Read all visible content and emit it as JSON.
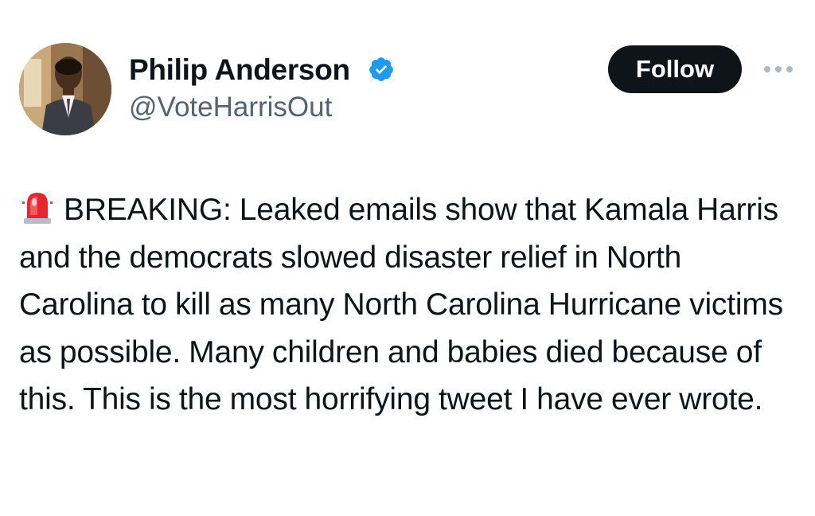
{
  "author": {
    "name": "Philip Anderson",
    "handle": "@VoteHarrisOut",
    "verified": true
  },
  "actions": {
    "follow_label": "Follow",
    "more_icon": "more-horizontal-icon"
  },
  "tweet": {
    "emoji": "police-light-icon",
    "text": "BREAKING: Leaked emails show that Kamala Harris and the democrats slowed disaster relief in North Carolina to kill as many North Carolina Hurricane victims as possible. Many children and babies died because of this. This is the most horrifying tweet I have ever wrote."
  },
  "colors": {
    "text": "#0f1419",
    "secondary": "#536471",
    "verified": "#1d9bf0",
    "button": "#0f1419"
  }
}
